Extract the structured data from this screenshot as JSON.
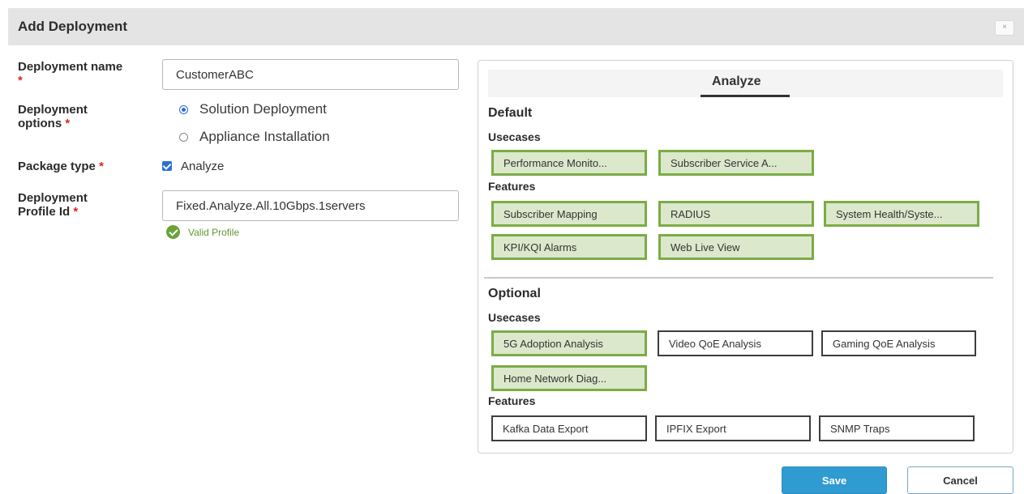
{
  "dialog": {
    "title": "Add Deployment",
    "close_label": "×"
  },
  "form": {
    "name_label": "Deployment name",
    "name_value": "CustomerABC",
    "options_label_line1": "Deployment",
    "options_label_line2": "options",
    "options": [
      {
        "label": "Solution Deployment",
        "selected": true
      },
      {
        "label": "Appliance Installation",
        "selected": false
      }
    ],
    "package_label": "Package type",
    "package_checkbox_label": "Analyze",
    "package_checked": true,
    "profile_label_line1": "Deployment",
    "profile_label_line2": "Profile Id",
    "profile_value": "Fixed.Analyze.All.10Gbps.1servers",
    "valid_text": "Valid Profile",
    "required_mark": "*"
  },
  "panel": {
    "tab": "Analyze",
    "default_title": "Default",
    "default_usecases_title": "Usecases",
    "default_usecases": [
      "Performance Monito...",
      "Subscriber Service A..."
    ],
    "default_features_title": "Features",
    "default_features": [
      "Subscriber Mapping",
      "RADIUS",
      "System Health/Syste...",
      "KPI/KQI Alarms",
      "Web Live View"
    ],
    "optional_title": "Optional",
    "optional_usecases_title": "Usecases",
    "optional_usecases": [
      {
        "label": "5G Adoption Analysis",
        "selected": true
      },
      {
        "label": "Video QoE Analysis",
        "selected": false
      },
      {
        "label": "Gaming QoE Analysis",
        "selected": false
      },
      {
        "label": "Home Network Diag...",
        "selected": true
      }
    ],
    "optional_features_title": "Features",
    "optional_features": [
      {
        "label": "Kafka Data Export",
        "selected": false
      },
      {
        "label": "IPFIX Export",
        "selected": false
      },
      {
        "label": "SNMP Traps",
        "selected": false
      }
    ]
  },
  "footer": {
    "save_label": "Save",
    "cancel_label": "Cancel"
  },
  "colors": {
    "accent": "#2f9bd1",
    "selected_chip_bg": "#dbe8cc",
    "selected_chip_border": "#7bac45",
    "required": "#d9261c"
  }
}
